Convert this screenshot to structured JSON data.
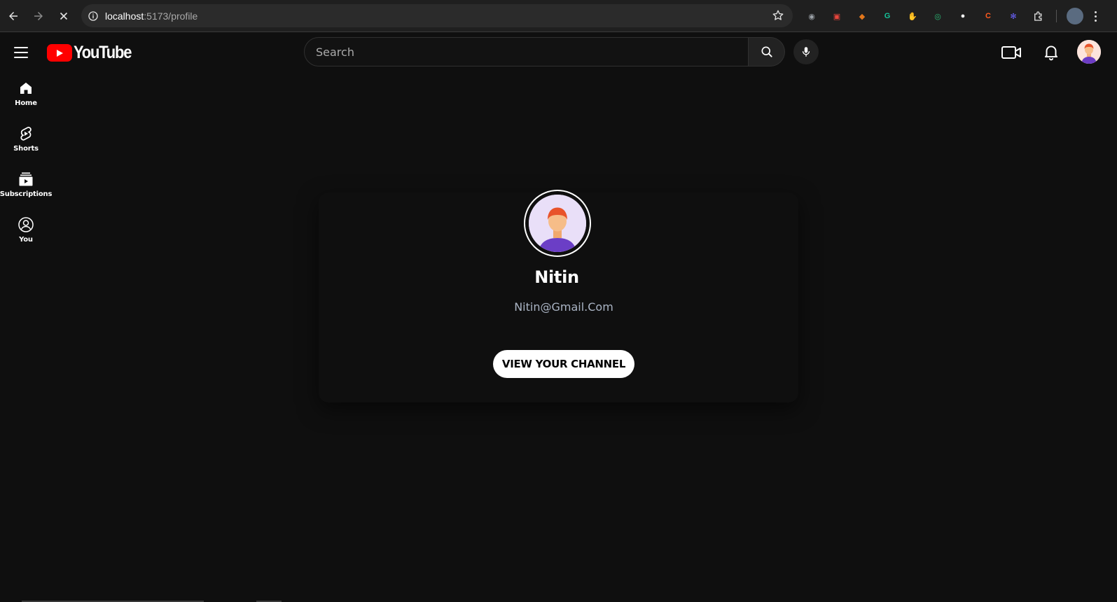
{
  "browser": {
    "url_host": "localhost",
    "url_path": ":5173/profile",
    "extensions": [
      {
        "name": "camera-extension-icon",
        "color": "#9aa0a6",
        "glyph": "◉"
      },
      {
        "name": "red-extension-icon",
        "color": "#e8453c",
        "glyph": "▣"
      },
      {
        "name": "fox-extension-icon",
        "color": "#e2761b",
        "glyph": "◆"
      },
      {
        "name": "grammarly-extension-icon",
        "color": "#15c39a",
        "glyph": "G"
      },
      {
        "name": "stop-extension-icon",
        "color": "#e0191f",
        "glyph": "✋"
      },
      {
        "name": "target-extension-icon",
        "color": "#2bb673",
        "glyph": "◎"
      },
      {
        "name": "white-circle-extension-icon",
        "color": "#f1f1f1",
        "glyph": "●"
      },
      {
        "name": "ci-extension-icon",
        "color": "#ff5a1f",
        "glyph": "C"
      },
      {
        "name": "gear-extension-icon",
        "color": "#6c63ff",
        "glyph": "✻"
      }
    ]
  },
  "header": {
    "logo_text": "YouTube",
    "search_placeholder": "Search"
  },
  "sidebar": {
    "items": [
      {
        "label": "Home",
        "icon": "home-icon"
      },
      {
        "label": "Shorts",
        "icon": "shorts-icon"
      },
      {
        "label": "Subscriptions",
        "icon": "subscriptions-icon"
      },
      {
        "label": "You",
        "icon": "you-icon"
      }
    ]
  },
  "profile": {
    "name": "Nitin",
    "email": "Nitin@Gmail.Com",
    "view_channel_label": "VIEW YOUR CHANNEL"
  },
  "colors": {
    "background": "#0f0f0f",
    "brand_red": "#ff0000",
    "email_text": "#aab4c4"
  }
}
